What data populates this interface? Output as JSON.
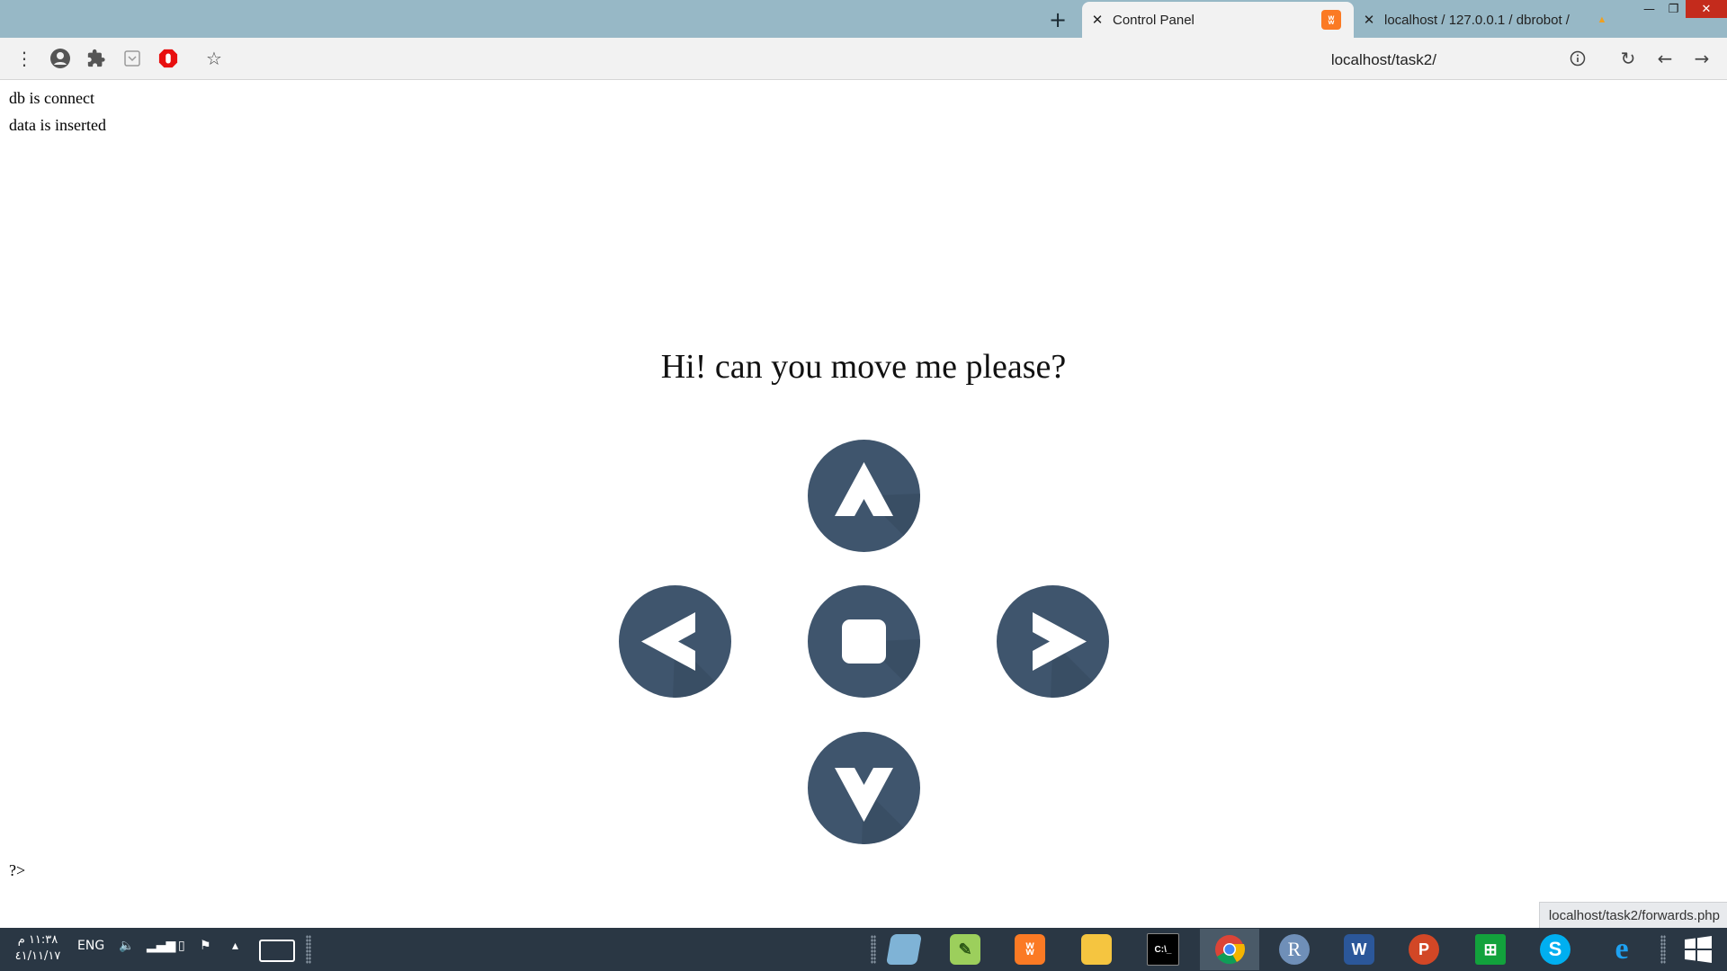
{
  "window": {
    "minimize": "—",
    "maximize": "❐",
    "close": "✕"
  },
  "tabs": [
    {
      "title": "Control Panel",
      "favicon": "xampp-icon",
      "active": true
    },
    {
      "title": "localhost / 127.0.0.1 / dbrobot /",
      "favicon": "phpmyadmin-icon",
      "active": false
    }
  ],
  "toolbar": {
    "url": "localhost/task2/"
  },
  "page": {
    "line1": "db is connect",
    "line2": "data is inserted",
    "heading": "Hi! can you move me please?",
    "footer_text": "?>",
    "controls": [
      "forward",
      "left",
      "stop",
      "right",
      "backward"
    ],
    "control_color": "#3f556d"
  },
  "status_bar": {
    "hover_url": "localhost/task2/forwards.php"
  },
  "taskbar": {
    "time": "١١:٣٨ م",
    "date": "٤١/١١/١٧",
    "language": "ENG",
    "apps": [
      "notepad",
      "notepad-plus",
      "xampp",
      "file-explorer",
      "cmd",
      "chrome",
      "r",
      "word",
      "powerpoint",
      "store",
      "skype",
      "internet-explorer"
    ]
  }
}
